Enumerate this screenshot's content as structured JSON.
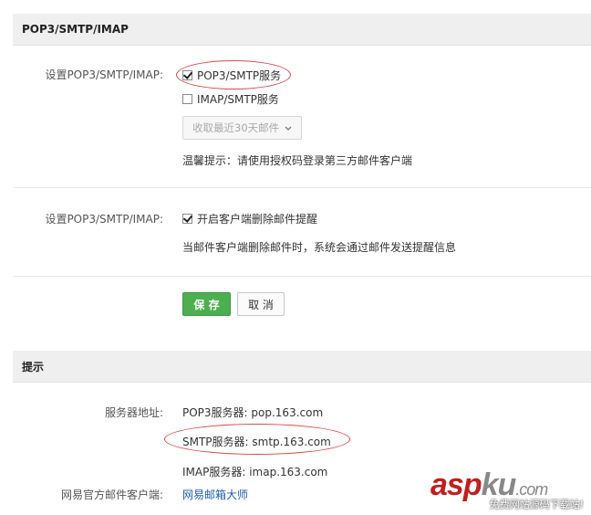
{
  "pop_panel": {
    "title": "POP3/SMTP/IMAP",
    "row1": {
      "label": "设置POP3/SMTP/IMAP:",
      "pop3_smtp": {
        "label": "POP3/SMTP服务",
        "checked": true
      },
      "imap_smtp": {
        "label": "IMAP/SMTP服务",
        "checked": false
      },
      "receive_select": {
        "value": "收取最近30天邮件"
      },
      "tip": "温馨提示：请使用授权码登录第三方邮件客户端"
    },
    "row2": {
      "label": "设置POP3/SMTP/IMAP:",
      "delete_notice": {
        "label": "开启客户端删除邮件提醒",
        "checked": true
      },
      "desc": "当邮件客户端删除邮件时，系统会通过邮件发送提醒信息"
    },
    "actions": {
      "save_label": "保 存",
      "cancel_label": "取 消"
    }
  },
  "tip_panel": {
    "title": "提示",
    "server_label": "服务器地址:",
    "pop3_server": "POP3服务器: pop.163.com",
    "smtp_server": "SMTP服务器: smtp.163.com",
    "imap_server": "IMAP服务器: imap.163.com",
    "client_label": "网易官方邮件客户端:",
    "client_link": "网易邮箱大师"
  },
  "watermark": {
    "brand_red": "asp",
    "brand_gray": "ku",
    "brand_suffix": ".com",
    "tagline": "免费网站源码下载站!"
  },
  "colors": {
    "primary_button": "#4caf50",
    "link": "#1d5fb0",
    "annotation_oval": "#d94a4a"
  }
}
